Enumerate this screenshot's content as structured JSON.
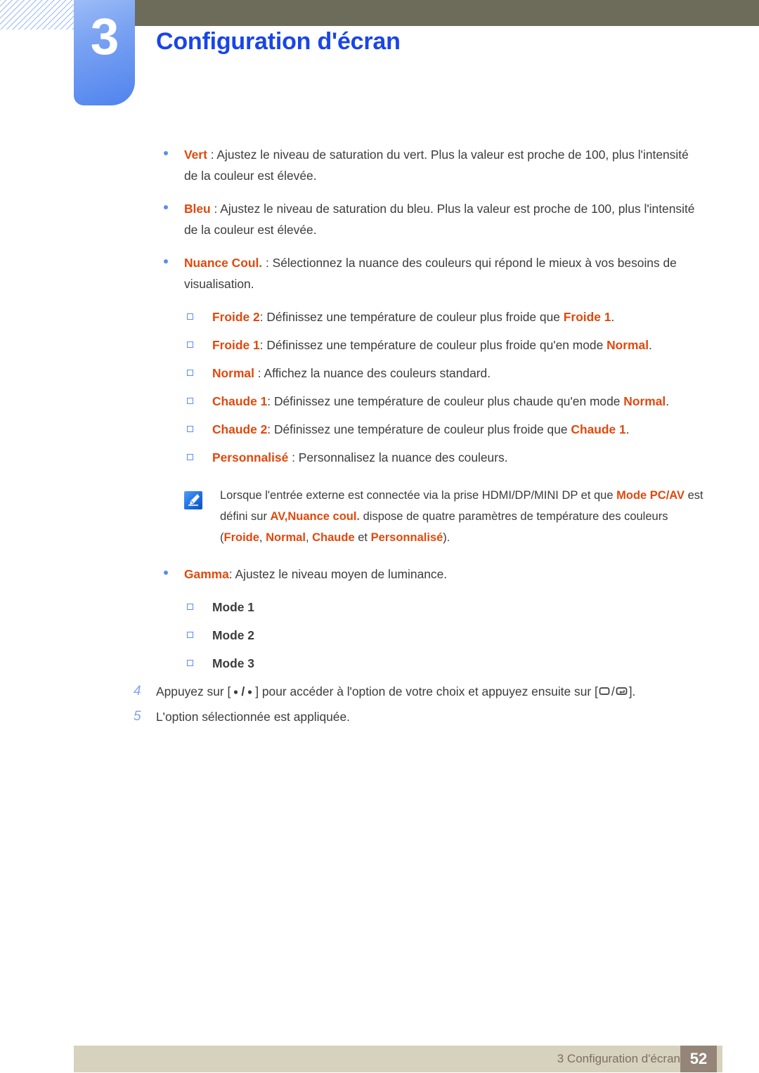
{
  "header": {
    "chapter_number": "3",
    "chapter_title": "Configuration d'écran",
    "olive_bar_color": "#6d6c5a",
    "tab_color": "#4f83ee",
    "title_color": "#1945e8"
  },
  "colors": {
    "accent_orange": "#e0490d",
    "bullet_blue": "#5b8def",
    "body_text": "#3c3c3c",
    "footer_bar": "#d7d2bd",
    "page_box": "#948578"
  },
  "bullets": [
    {
      "term": "Vert",
      "sep": " : ",
      "text": "Ajustez le niveau de saturation du vert. Plus la valeur est proche de 100, plus l'intensité de la couleur est élevée."
    },
    {
      "term": "Bleu",
      "sep": " : ",
      "text": "Ajustez le niveau de saturation du bleu. Plus la valeur est proche de 100, plus l'intensité de la couleur est élevée."
    },
    {
      "term": "Nuance Coul.",
      "sep": " : ",
      "text": "Sélectionnez la nuance des couleurs qui répond le mieux à vos besoins de visualisation."
    }
  ],
  "nuance_options": [
    {
      "term": "Froide 2",
      "sep": ": ",
      "text_before": "Définissez une température de couleur plus froide que ",
      "term2": "Froide 1",
      "text_after": "."
    },
    {
      "term": "Froide 1",
      "sep": ": ",
      "text_before": "Définissez une température de couleur plus froide qu'en mode ",
      "term2": "Normal",
      "text_after": "."
    },
    {
      "term": "Normal",
      "sep": " : ",
      "text_before": "Affichez la nuance des couleurs standard.",
      "term2": "",
      "text_after": ""
    },
    {
      "term": "Chaude 1",
      "sep": ": ",
      "text_before": "Définissez une température de couleur plus chaude qu'en mode ",
      "term2": "Normal",
      "text_after": "."
    },
    {
      "term": "Chaude 2",
      "sep": ": ",
      "text_before": "Définissez une température de couleur plus froide que ",
      "term2": "Chaude 1",
      "text_after": "."
    },
    {
      "term": "Personnalisé",
      "sep": " : ",
      "text_before": "Personnalisez la nuance des couleurs.",
      "term2": "",
      "text_after": ""
    }
  ],
  "note": {
    "icon_name": "note-pen-icon",
    "part1": "Lorsque l'entrée externe est connectée via la prise HDMI/DP/MINI DP et que ",
    "emph1": "Mode PC/AV",
    "part2": " est défini sur ",
    "emph2": "AV",
    "part3": ",",
    "emph3": "Nuance coul.",
    "part4": " dispose de quatre paramètres de température des couleurs (",
    "emph4": "Froide",
    "part5": ", ",
    "emph5": "Normal",
    "part6": ", ",
    "emph6": "Chaude",
    "part7": " et ",
    "emph7": "Personnalisé",
    "part8": ")."
  },
  "gamma": {
    "term": "Gamma",
    "sep": ": ",
    "text": "Ajustez le niveau moyen de luminance.",
    "modes": [
      "Mode 1",
      "Mode 2",
      "Mode 3"
    ]
  },
  "steps": [
    {
      "num": "4",
      "part1": "Appuyez sur [",
      "key_a": "•",
      "key_sep": "/",
      "key_b": "•",
      "part2": "] pour accéder à l'option de votre choix et appuyez ensuite sur [",
      "glyph_a": "menu-key-icon",
      "glyph_sep": "/",
      "glyph_b": "enter-key-icon",
      "part3": "]."
    },
    {
      "num": "5",
      "part1": "L'option sélectionnée est appliquée.",
      "key_a": "",
      "key_sep": "",
      "key_b": "",
      "part2": "",
      "part3": ""
    }
  ],
  "footer": {
    "text": "3 Configuration d'écran",
    "page": "52"
  }
}
